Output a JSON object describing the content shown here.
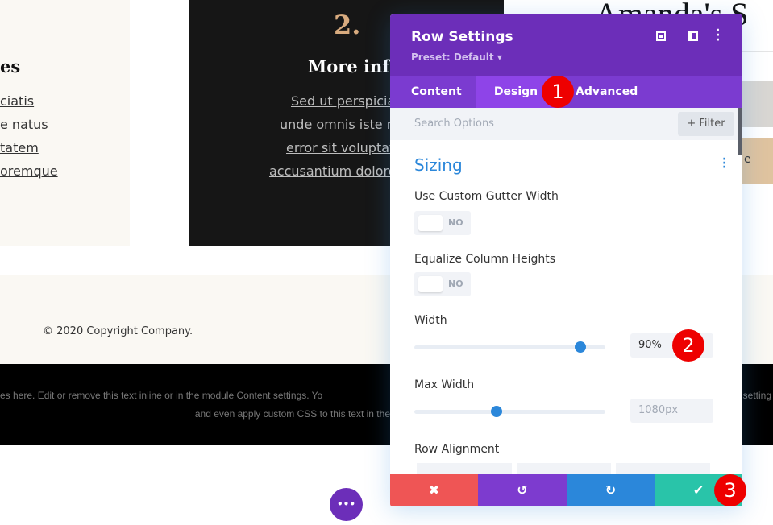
{
  "page": {
    "left_card": {
      "heading": "es",
      "links": [
        "ciatis",
        "e natus",
        "tatem",
        "oremque"
      ]
    },
    "dark_card": {
      "number": "2.",
      "heading": "More info",
      "links": [
        "Sed ut perspiciati",
        "unde omnis iste na",
        "error sit voluptate",
        "accusantium dolorem"
      ]
    },
    "right_title": "Amanda's S",
    "right_snippet": "e",
    "copyright": "© 2020 Copyright Company.",
    "footer_line1_left": "es here. Edit or remove this text inline or in the module Content settings. Yo",
    "footer_line1_right": "setting",
    "footer_line2": "and even apply custom CSS to this text in the"
  },
  "panel": {
    "title": "Row Settings",
    "preset": "Preset: Default ▾",
    "tabs": [
      {
        "label": "Content"
      },
      {
        "label": "Design",
        "active": true
      },
      {
        "label": "Advanced"
      }
    ],
    "search_placeholder": "Search Options",
    "filter_label": "+ Filter",
    "section_title": "Sizing",
    "fields": {
      "gutter": {
        "label": "Use Custom Gutter Width",
        "value": "NO"
      },
      "equalize": {
        "label": "Equalize Column Heights",
        "value": "NO"
      },
      "width": {
        "label": "Width",
        "value": "90%",
        "slider_fraction": 0.87
      },
      "max_width": {
        "label": "Max Width",
        "value": "1080px",
        "slider_fraction": 0.43
      },
      "row_alignment": {
        "label": "Row Alignment"
      }
    },
    "footer_buttons": [
      {
        "name": "cancel",
        "icon": "✖",
        "color": "#ef5555"
      },
      {
        "name": "undo",
        "icon": "↺",
        "color": "#7d3bcf"
      },
      {
        "name": "redo",
        "icon": "↻",
        "color": "#2b87da"
      },
      {
        "name": "save",
        "icon": "✔",
        "color": "#29c4a9"
      }
    ]
  },
  "badges": [
    "1",
    "2",
    "3"
  ],
  "colors": {
    "header": "#6c2eb9",
    "tabs": "#7b3bd0",
    "active_tab": "#8e44e8",
    "accent": "#2b87da",
    "badge": "#ee0000",
    "more_button": "#6c2eb9"
  },
  "more_button_icon": "•••"
}
